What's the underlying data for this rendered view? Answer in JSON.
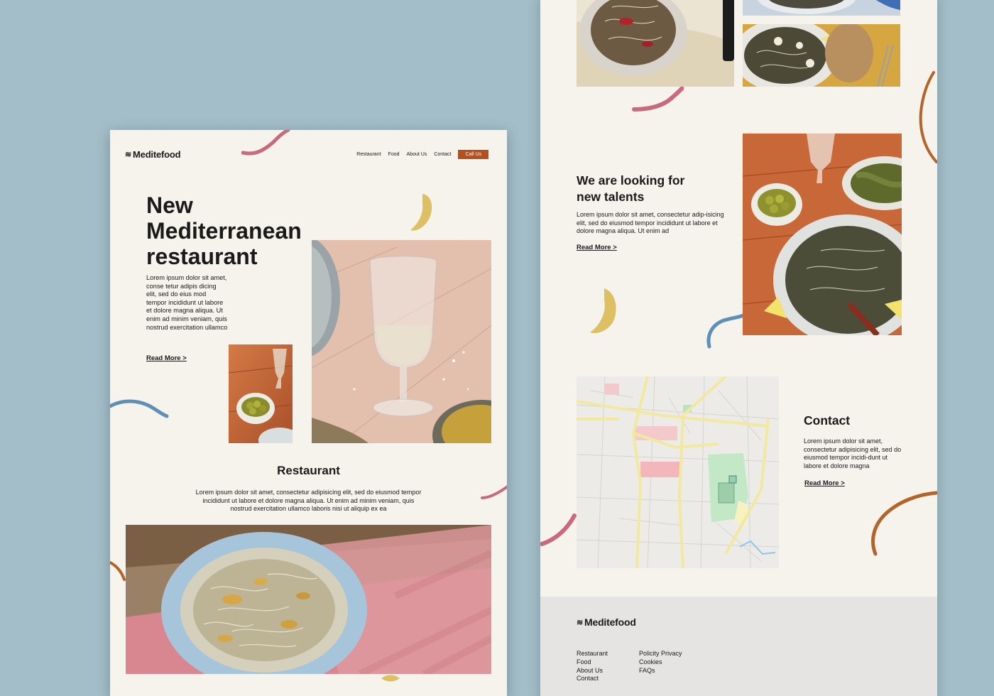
{
  "brand": {
    "name": "Meditefood",
    "logo_icon": "wave-grid-icon"
  },
  "nav": {
    "items": [
      "Restaurant",
      "Food",
      "About Us",
      "Contact"
    ],
    "cta": "Call Us"
  },
  "hero": {
    "title_lines": [
      "New",
      "Mediterranean",
      "restaurant"
    ],
    "text": "Lorem ipsum dolor sit amet, conse tetur adipis dicing elit, sed do eius mod tempor incididunt ut labore et dolore magna aliqua. Ut enim ad minim veniam, quis nostrud exercitation ullamco",
    "read_more": "Read More >"
  },
  "restaurant": {
    "title": "Restaurant",
    "text": "Lorem ipsum dolor sit amet, consectetur adipisicing elit, sed do eiusmod tempor incididunt ut labore et dolore magna aliqua. Ut enim ad minim veniam, quis nostrud exercitation ullamco laboris nisi ut aliquip ex ea"
  },
  "talents": {
    "title_lines": [
      "We are looking for",
      "new talents"
    ],
    "text": "Lorem ipsum dolor sit amet, consectetur adip-isicing elit, sed do eiusmod tempor incididunt ut labore et dolore magna aliqua. Ut enim ad",
    "read_more": "Read More >"
  },
  "contact": {
    "title": "Contact",
    "text": "Lorem ipsum dolor sit amet, consectetur adipisicing elit, sed do eiusmod tempor incidi-dunt ut labore et dolore magna",
    "read_more": "Read More >"
  },
  "footer": {
    "col1": [
      "Restaurant",
      "Food",
      "About Us",
      "Contact"
    ],
    "col2": [
      "Policity Privacy",
      "Cookies",
      "FAQs"
    ]
  },
  "colors": {
    "background": "#a3bec8",
    "page": "#f6f2ec",
    "accent": "#b3501d",
    "pink": "#c96a7c",
    "yellow": "#dcc063",
    "blue": "#5e8fb7",
    "brown": "#b3642a",
    "footer": "#e6e4e3"
  }
}
